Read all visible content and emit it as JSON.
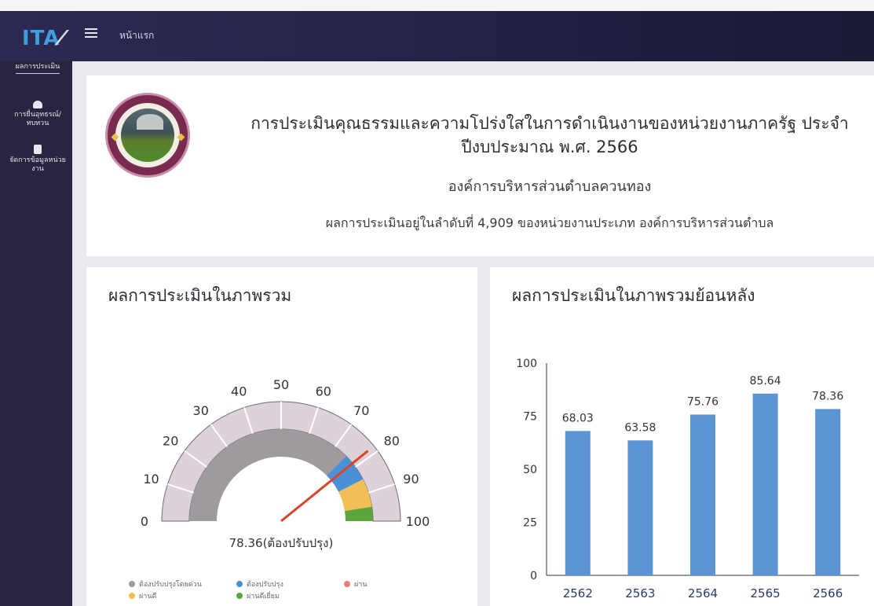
{
  "topbar": {
    "logo": "ITA",
    "home_link": "หน้าแรก"
  },
  "sidebar": {
    "items": [
      {
        "label": "ผลการประเมิน",
        "icon": "chart-icon",
        "active": true
      },
      {
        "label": "การยื่นอุทธรณ์/ทบทวน",
        "icon": "mail-icon"
      },
      {
        "label": "จัดการข้อมูลหน่วยงาน",
        "icon": "document-icon"
      }
    ]
  },
  "header": {
    "title": "การประเมินคุณธรรมและความโปร่งใสในการดำเนินงานของหน่วยงานภาครัฐ ประจำปีงบประมาณ พ.ศ. 2566",
    "org": "องค์การบริหารส่วนตำบลควนทอง",
    "rank": "ผลการประเมินอยู่ในลำดับที่ 4,909 ของหน่วยงานประเภท องค์การบริหารส่วนตำบล"
  },
  "overall": {
    "title": "ผลการประเมินในภาพรวม",
    "score": 78.36,
    "score_label": "78.36(ต้องปรับปรุง)",
    "gauge": {
      "min": 0,
      "max": 100,
      "ticks": [
        0,
        10,
        20,
        30,
        40,
        50,
        60,
        70,
        80,
        90,
        100
      ]
    },
    "bands": [
      {
        "from": 0,
        "to": 75,
        "color": "#9e9a9e"
      },
      {
        "from": 75,
        "to": 85,
        "color": "#4a90d6"
      },
      {
        "from": 85,
        "to": 95,
        "color": "#f2bf57"
      },
      {
        "from": 95,
        "to": 100,
        "color": "#5aa63a"
      }
    ],
    "needle_color": "#d9442a",
    "legend": [
      {
        "label": "ต้องปรับปรุงโดยด่วน",
        "color": "#9e9a9e"
      },
      {
        "label": "ต้องปรับปรุง",
        "color": "#4a90d6"
      },
      {
        "label": "ผ่าน",
        "color": "#e97a78"
      },
      {
        "label": "ผ่านดี",
        "color": "#f2bf57"
      },
      {
        "label": "ผ่านดีเยี่ยม",
        "color": "#5aa63a"
      }
    ]
  },
  "history_title": "ผลการประเมินในภาพรวมย้อนหลัง",
  "chart_data": {
    "type": "bar",
    "categories": [
      "2562",
      "2563",
      "2564",
      "2565",
      "2566"
    ],
    "values": [
      68.03,
      63.58,
      75.76,
      85.64,
      78.36
    ],
    "ylim": [
      0,
      100
    ],
    "yticks": [
      0,
      25,
      50,
      75,
      100
    ],
    "bar_color": "#5b93d3"
  }
}
